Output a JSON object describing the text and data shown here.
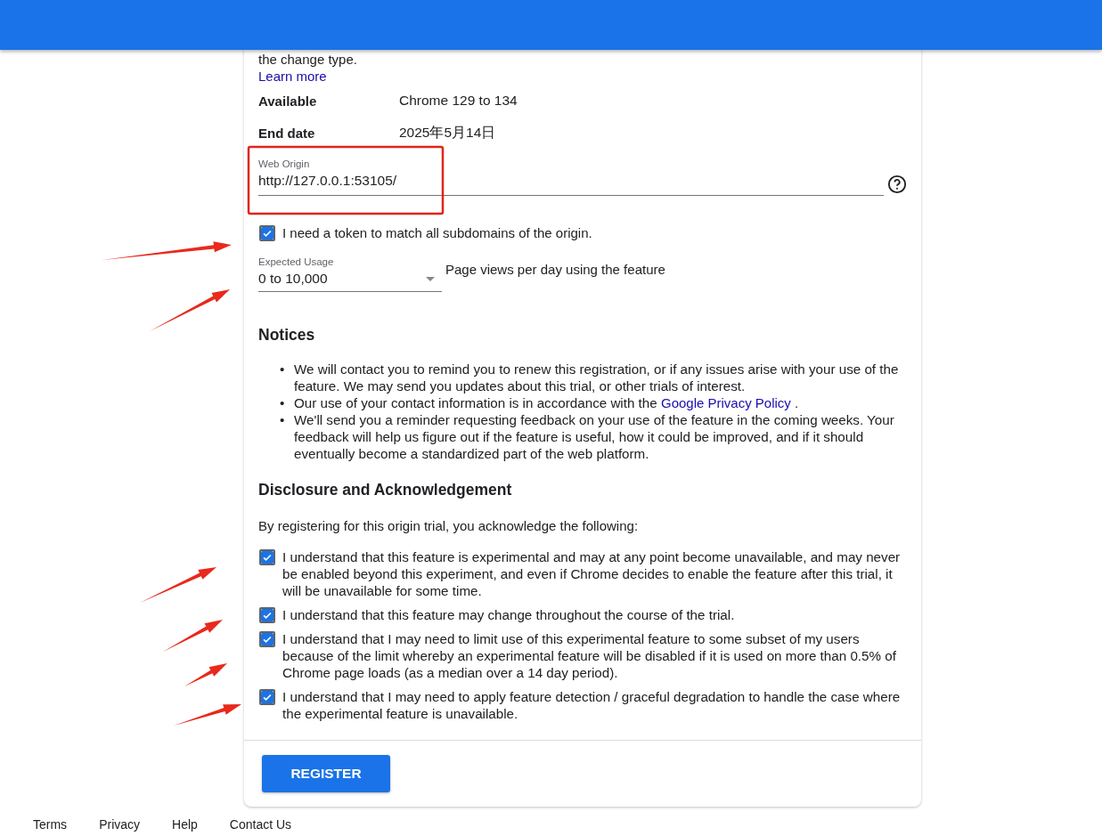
{
  "header": {
    "kind": "bar"
  },
  "intro": {
    "text": "the change type.",
    "link": "Learn more"
  },
  "details": [
    {
      "label": "Available",
      "value": "Chrome 129 to 134"
    },
    {
      "label": "End date",
      "value": "2025年5月14日"
    }
  ],
  "web_origin": {
    "label": "Web Origin",
    "value": "http://127.0.0.1:53105/"
  },
  "subdomain_checkbox": {
    "label": "I need a token to match all subdomains of the origin.",
    "checked": true
  },
  "expected_usage": {
    "label": "Expected Usage",
    "value": "0 to 10,000",
    "hint": "Page views per day using the feature"
  },
  "notices": {
    "heading": "Notices",
    "items": [
      {
        "bullet": "•",
        "text": "We will contact you to remind you to renew this registration, or if any issues arise with your use of the feature. We may send you updates about this trial, or other trials of interest."
      },
      {
        "bullet": "•",
        "text": "Our use of your contact information is in accordance with the",
        "link": "Google Privacy Policy",
        "after": "."
      },
      {
        "bullet": "•",
        "text": "We'll send you a reminder requesting feedback on your use of the feature in the coming weeks. Your feedback will help us figure out if the feature is useful, how it could be improved, and if it should eventually become a standardized part of the web platform."
      }
    ]
  },
  "disclosure": {
    "heading": "Disclosure and Acknowledgement",
    "intro": "By registering for this origin trial, you acknowledge the following:",
    "items": [
      {
        "label": "I understand that this feature is experimental and may at any point become unavailable, and may never be enabled beyond this experiment, and even if Chrome decides to enable the feature after this trial, it will be unavailable for some time.",
        "checked": true
      },
      {
        "label": "I understand that this feature may change throughout the course of the trial.",
        "checked": true
      },
      {
        "label": "I understand that I may need to limit use of this experimental feature to some subset of my users because of the limit whereby an experimental feature will be disabled if it is used on more than 0.5% of Chrome page loads (as a median over a 14 day period).",
        "checked": true
      },
      {
        "label": "I understand that I may need to apply feature detection / graceful degradation to handle the case where the experimental feature is unavailable.",
        "checked": true
      }
    ]
  },
  "register_button": "REGISTER",
  "footer_links": [
    "Terms",
    "Privacy",
    "Help",
    "Contact Us"
  ],
  "annotations": [
    {
      "kind": "box"
    },
    {
      "kind": "arrow"
    },
    {
      "kind": "arrow"
    },
    {
      "kind": "arrow"
    },
    {
      "kind": "arrow"
    },
    {
      "kind": "arrow"
    },
    {
      "kind": "arrow"
    }
  ]
}
